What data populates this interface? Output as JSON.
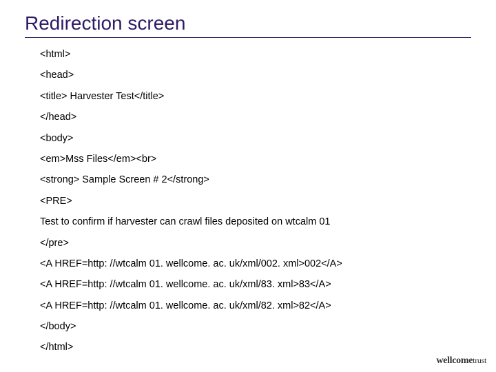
{
  "title": "Redirection screen",
  "lines": [
    "<html>",
    "<head>",
    "<title> Harvester Test</title>",
    "</head>",
    "<body>",
    "<em>Mss Files</em><br>",
    "<strong> Sample Screen # 2</strong>",
    "<PRE>",
    "Test to confirm if harvester can crawl files deposited on wtcalm 01",
    "</pre>",
    "<A HREF=http: //wtcalm 01. wellcome. ac. uk/xml/002. xml>002</A>",
    "<A HREF=http: //wtcalm 01. wellcome. ac. uk/xml/83. xml>83</A>",
    "<A HREF=http: //wtcalm 01. wellcome. ac. uk/xml/82. xml>82</A>",
    "</body>",
    "</html>"
  ],
  "logo": {
    "brand": "wellcome",
    "suffix": "trust"
  }
}
